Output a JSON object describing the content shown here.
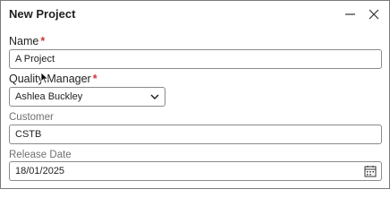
{
  "dialog": {
    "title": "New Project",
    "minimize_icon": "minimize-icon",
    "close_icon": "close-icon"
  },
  "fields": {
    "name": {
      "label": "Name",
      "required_mark": "*",
      "value": "A Project"
    },
    "quality_manager": {
      "label": "Quality Manager",
      "required_mark": "*",
      "value": "Ashlea Buckley",
      "icon": "chevron-down-icon"
    },
    "customer": {
      "label": "Customer",
      "value": "CSTB"
    },
    "release_date": {
      "label": "Release Date",
      "value": "18/01/2025",
      "icon": "calendar-icon"
    }
  },
  "colors": {
    "required": "#d13438",
    "border": "#8a8a8a",
    "muted_label": "#707070"
  }
}
